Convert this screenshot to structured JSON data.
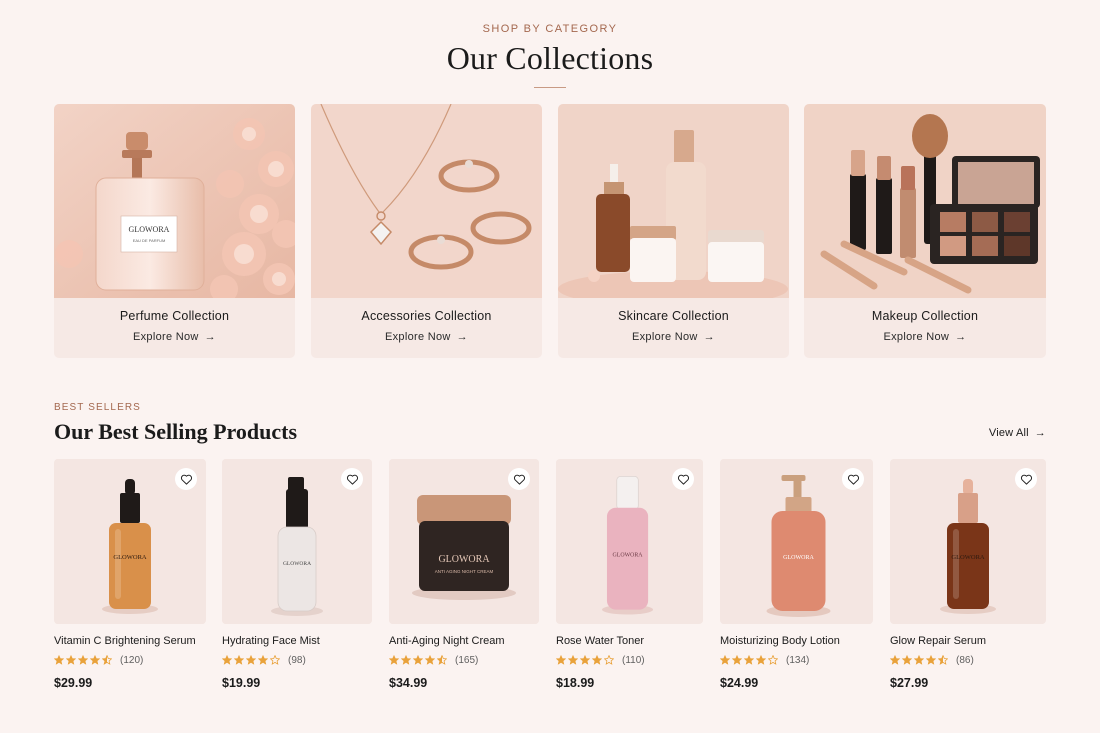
{
  "collections": {
    "eyebrow": "SHOP BY CATEGORY",
    "title": "Our Collections",
    "items": [
      {
        "name": "Perfume Collection",
        "cta": "Explore Now",
        "image_label": "perfume bottle with roses",
        "brand": "GLOWORA",
        "sublabel": "EAU DE PARFUM"
      },
      {
        "name": "Accessories Collection",
        "cta": "Explore Now",
        "image_label": "rose gold necklace and rings"
      },
      {
        "name": "Skincare Collection",
        "cta": "Explore Now",
        "image_label": "serum bottles and cream jars"
      },
      {
        "name": "Makeup Collection",
        "cta": "Explore Now",
        "image_label": "lipsticks, brush and eyeshadow palette"
      }
    ]
  },
  "best_sellers": {
    "eyebrow": "BEST SELLERS",
    "title": "Our Best Selling Products",
    "view_all": "View All",
    "products": [
      {
        "name": "Vitamin C Brightening Serum",
        "rating": 4.5,
        "reviews": "(120)",
        "price": "$29.99",
        "type": "dropper",
        "color": "#d9904a",
        "brand": "GLOWORA"
      },
      {
        "name": "Hydrating Face Mist",
        "rating": 4.0,
        "reviews": "(98)",
        "price": "$19.99",
        "type": "spray",
        "color": "#ece6e4",
        "brand": "GLOWORA"
      },
      {
        "name": "Anti-Aging Night Cream",
        "rating": 4.5,
        "reviews": "(165)",
        "price": "$34.99",
        "type": "jar",
        "color": "#2f2522",
        "brand": "GLOWORA",
        "sublabel": "ANTI AGING NIGHT CREAM"
      },
      {
        "name": "Rose Water Toner",
        "rating": 4.0,
        "reviews": "(110)",
        "price": "$18.99",
        "type": "toner",
        "color": "#eab3bf",
        "brand": "GLOWORA"
      },
      {
        "name": "Moisturizing Body Lotion",
        "rating": 4.0,
        "reviews": "(134)",
        "price": "$24.99",
        "type": "pump",
        "color": "#de8a70",
        "brand": "GLOWORA"
      },
      {
        "name": "Glow Repair Serum",
        "rating": 4.5,
        "reviews": "(86)",
        "price": "$27.99",
        "type": "dropper-dark",
        "color": "#7a3518",
        "brand": "GLOWORA"
      }
    ]
  },
  "colors": {
    "accent": "#a4684f",
    "star": "#e9a23b",
    "background": "#fbf3f1"
  },
  "icons": {
    "wishlist": "heart-icon",
    "arrow": "arrow-right-icon",
    "star": "star-icon"
  }
}
